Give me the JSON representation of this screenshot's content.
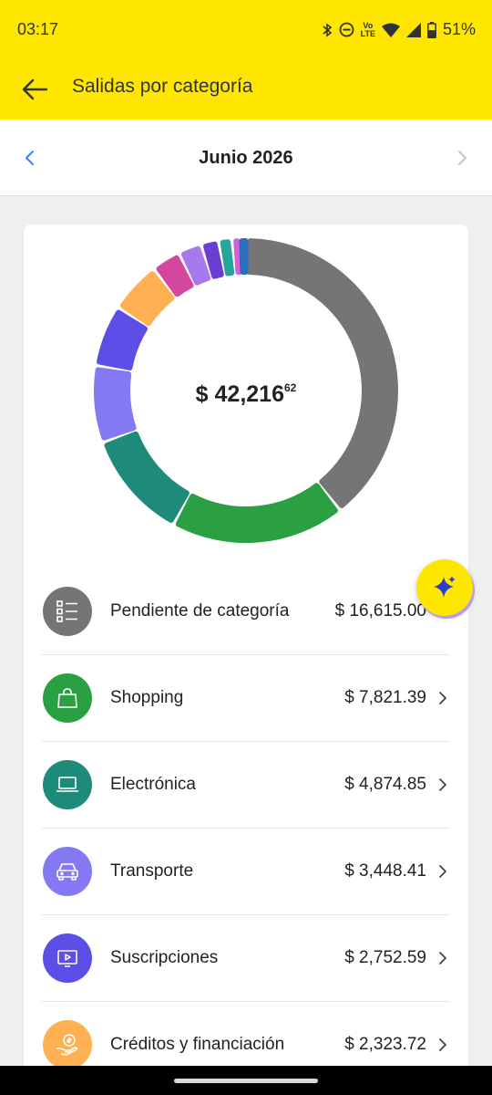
{
  "status_bar": {
    "time": "03:17",
    "lte_line1": "Vo",
    "lte_line2": "LTE",
    "battery": "51%",
    "icons": [
      "bluetooth-icon",
      "do-not-disturb-icon",
      "volte-icon",
      "wifi-icon",
      "signal-icon",
      "battery-icon"
    ]
  },
  "header": {
    "title": "Salidas por categoría",
    "background_color": "#ffe600"
  },
  "month_selector": {
    "label": "Junio 2026",
    "prev_icon": "chevron-left-icon",
    "next_icon": "chevron-right-icon"
  },
  "summary": {
    "total_main": "$ 42,216",
    "total_cents": "62"
  },
  "categories": [
    {
      "label": "Pendiente de categoría",
      "amount": "$ 16,615.00",
      "value": 16615.0,
      "color": "#757575",
      "icon": "list-icon"
    },
    {
      "label": "Shopping",
      "amount": "$ 7,821.39",
      "value": 7821.39,
      "color": "#2aa043",
      "icon": "shopping-bag-icon"
    },
    {
      "label": "Electrónica",
      "amount": "$ 4,874.85",
      "value": 4874.85,
      "color": "#1e8a7a",
      "icon": "laptop-icon"
    },
    {
      "label": "Transporte",
      "amount": "$ 3,448.41",
      "value": 3448.41,
      "color": "#8479f2",
      "icon": "car-icon"
    },
    {
      "label": "Suscripciones",
      "amount": "$ 2,752.59",
      "value": 2752.59,
      "color": "#5c4ee6",
      "icon": "tv-icon"
    },
    {
      "label": "Créditos y financiación",
      "amount": "$ 2,323.72",
      "value": 2323.72,
      "color": "#ffb052",
      "icon": "money-hand-icon"
    }
  ],
  "chart_data": {
    "type": "pie",
    "style": "donut",
    "slices": [
      {
        "label": "Pendiente de categoría",
        "value": 16615.0,
        "color": "#757575"
      },
      {
        "label": "Shopping",
        "value": 7821.39,
        "color": "#2aa043"
      },
      {
        "label": "Electrónica",
        "value": 4874.85,
        "color": "#1e8a7a"
      },
      {
        "label": "Transporte",
        "value": 3448.41,
        "color": "#8479f2"
      },
      {
        "label": "Suscripciones",
        "value": 2752.59,
        "color": "#5c4ee6"
      },
      {
        "label": "Créditos y financiación",
        "value": 2323.72,
        "color": "#ffb052"
      },
      {
        "label": "",
        "value": 1300,
        "color": "#d4479e"
      },
      {
        "label": "",
        "value": 1050,
        "color": "#a879ec"
      },
      {
        "label": "",
        "value": 780,
        "color": "#6a3ed1"
      },
      {
        "label": "",
        "value": 600,
        "color": "#25a698"
      },
      {
        "label": "",
        "value": 420,
        "color": "#d561d6"
      },
      {
        "label": "",
        "value": 210,
        "color": "#2a6ec0"
      }
    ]
  },
  "fab": {
    "icon": "sparkle-icon"
  }
}
